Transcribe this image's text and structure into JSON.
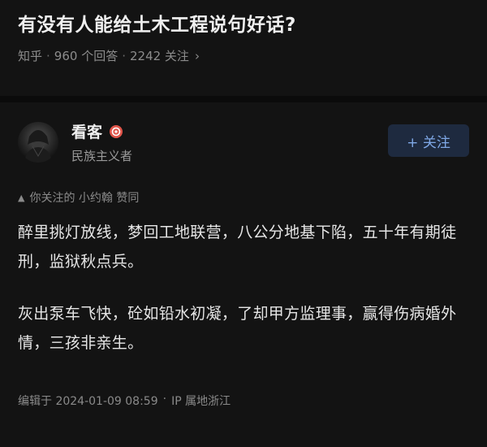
{
  "question": {
    "title": "有没有人能给土木工程说句好话?",
    "source": "知乎",
    "answers": "960 个回答",
    "followers": "2242 关注",
    "separator": "·",
    "chevron": "›"
  },
  "author": {
    "name": "看客",
    "bio": "民族主义者",
    "follow_label": "+ 关注",
    "badge_icon": "badge-icon",
    "badge_color": "#e0554a"
  },
  "upvote_note": {
    "icon": "triangle-up-icon",
    "text": "你关注的 小约翰 赞同"
  },
  "answer": {
    "paragraphs": [
      "醉里挑灯放线，梦回工地联营，八公分地基下陷，五十年有期徒刑，监狱秋点兵。",
      "灰出泵车飞快，砼如铅水初凝，了却甲方监理事，赢得伤病婚外情，三孩非亲生。"
    ]
  },
  "footer": {
    "edited": "编辑于 2024-01-09 08:59",
    "separator": "·",
    "ip": "IP 属地浙江"
  },
  "colors": {
    "background": "#131313",
    "follow_bg": "#1e2a3f",
    "follow_text": "#7fa8e6"
  }
}
